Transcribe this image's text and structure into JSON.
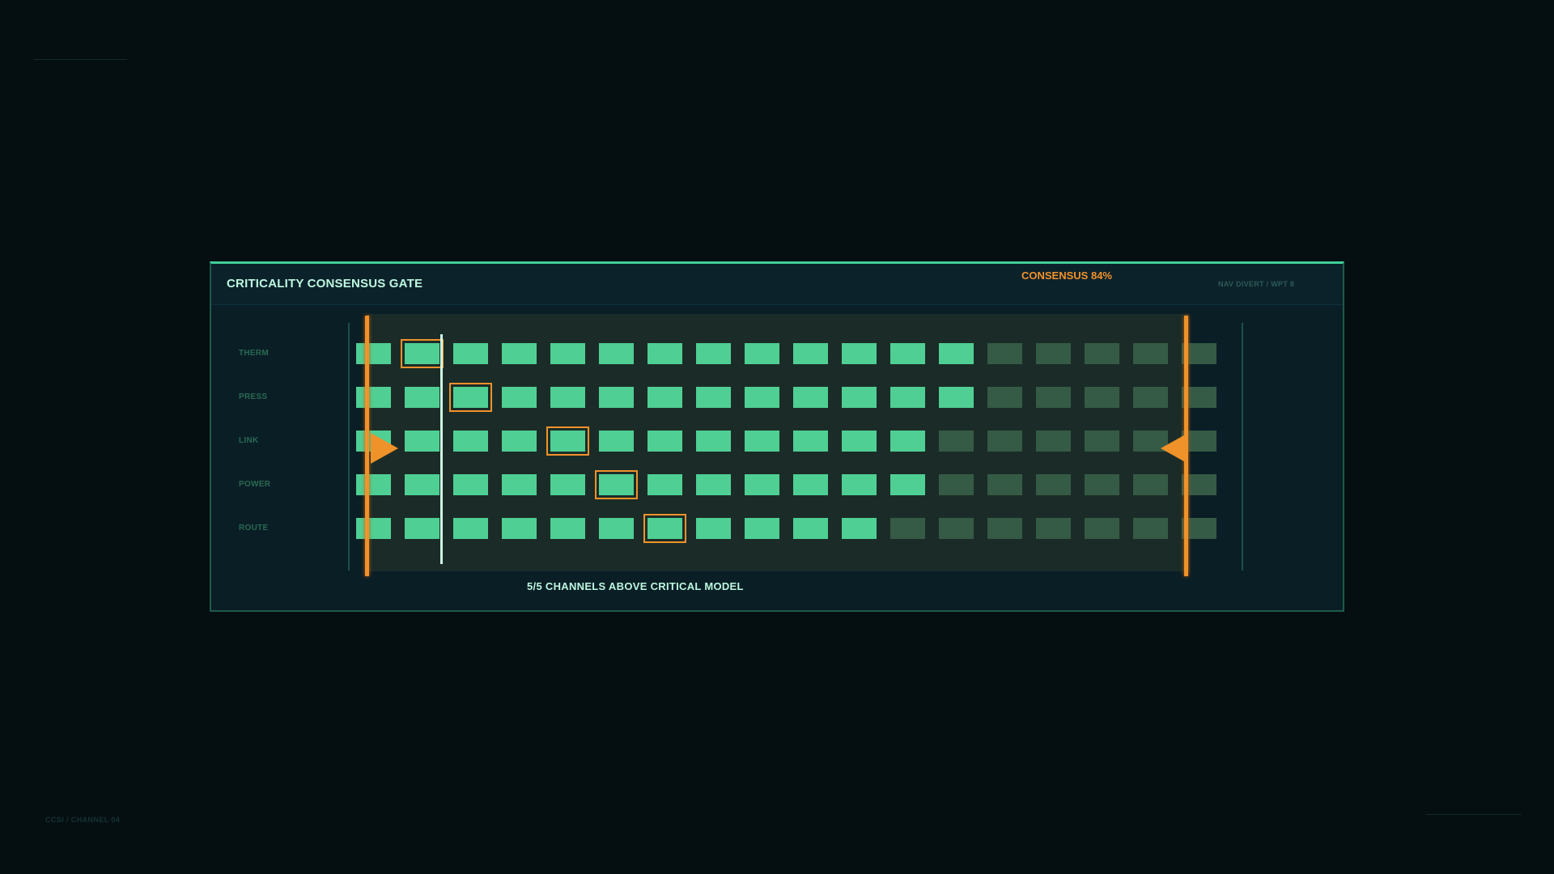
{
  "panel": {
    "title": "CRITICALITY CONSENSUS GATE",
    "consensus": "CONSENSUS 84%",
    "consensus_value_percent": 84,
    "nav": "NAV DIVERT / WPT 8",
    "status": "5/5 CHANNELS ABOVE CRITICAL MODEL"
  },
  "footer": {
    "code": "CCSI / CHANNEL 04"
  },
  "channels": [
    {
      "label": "THERM",
      "active_count": 13,
      "highlight_index": 1
    },
    {
      "label": "PRESS",
      "active_count": 13,
      "highlight_index": 2
    },
    {
      "label": "LINK",
      "active_count": 12,
      "highlight_index": 4
    },
    {
      "label": "POWER",
      "active_count": 12,
      "highlight_index": 5
    },
    {
      "label": "ROUTE",
      "active_count": 11,
      "highlight_index": 6
    }
  ],
  "cells_per_row": 18,
  "colors": {
    "accent_orange": "#f0922a",
    "active_cell": "#4fcf93",
    "inactive_cell": "#355a45",
    "title_text": "#bdf7df"
  }
}
